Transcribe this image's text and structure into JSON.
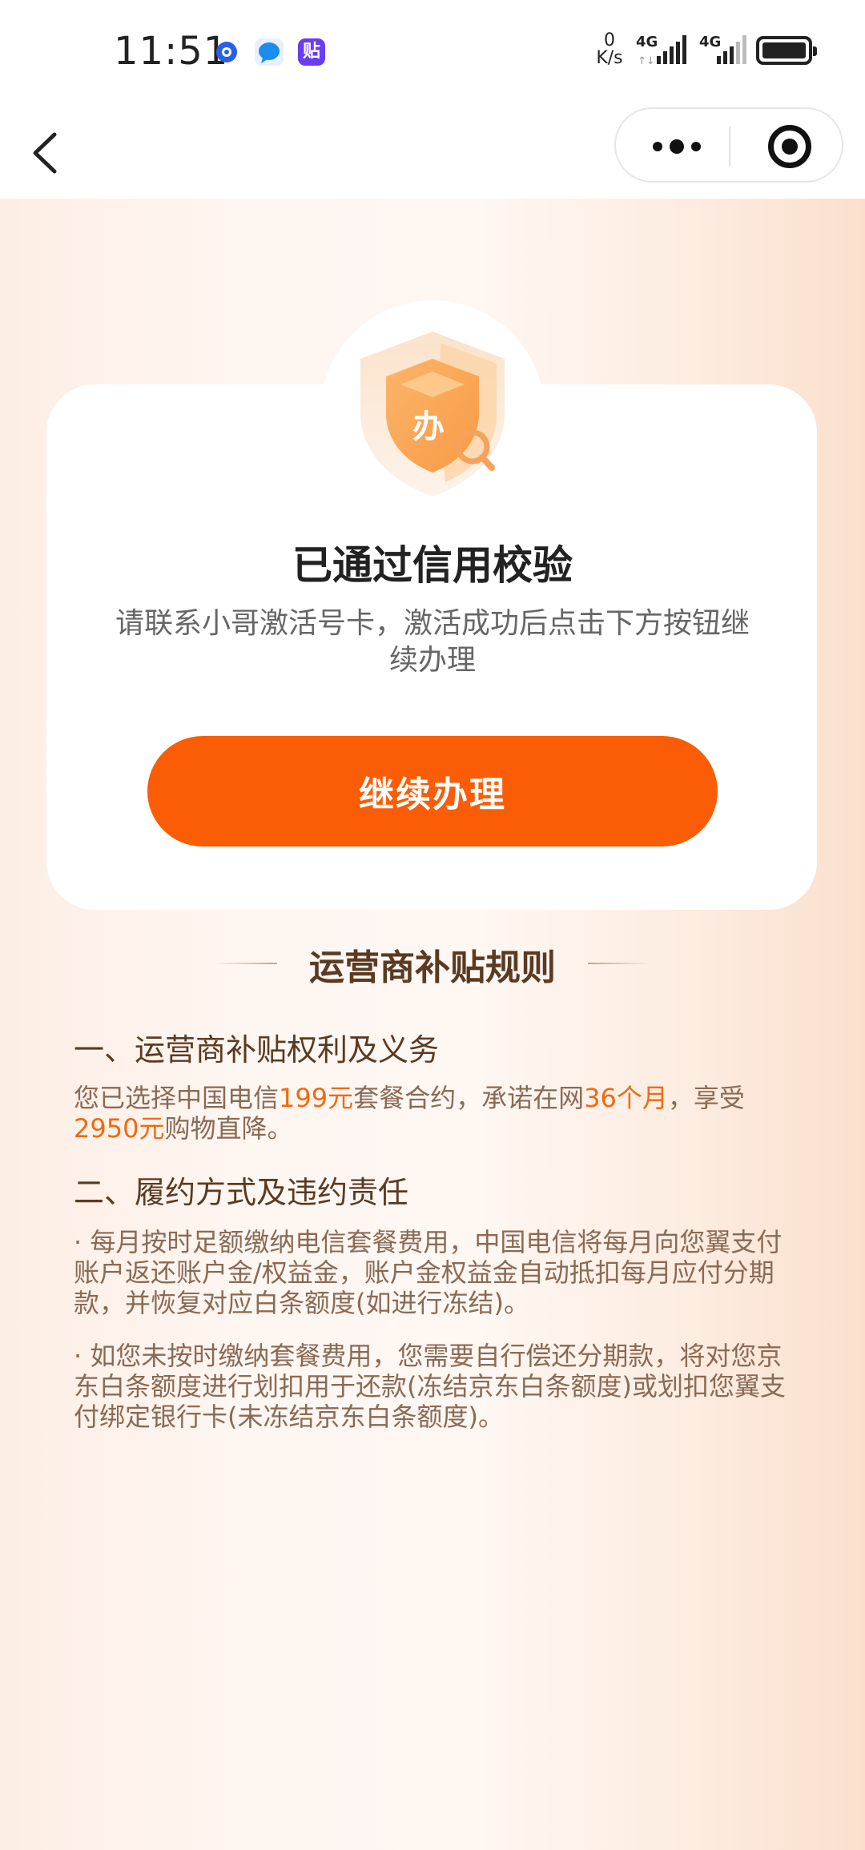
{
  "status_bar": {
    "time": "11:51",
    "net_speed_value": "0",
    "net_speed_unit": "K/s",
    "signal_1_label": "4G",
    "signal_2_label": "4G",
    "notif_3_label": "贴"
  },
  "nav": {
    "back_icon": "chevron-left-icon",
    "more_icon": "more-dots-icon",
    "close_icon": "target-circle-icon"
  },
  "card": {
    "badge_text": "办",
    "title": "已通过信用校验",
    "description": "请联系小哥激活号卡，激活成功后点击下方按钮继续办理",
    "button_label": "继续办理"
  },
  "rules": {
    "title": "运营商补贴规则",
    "section1": {
      "title": "一、运营商补贴权利及义务",
      "text_1": "您已选择中国电信",
      "plan_price": "199元",
      "text_2": "套餐合约，承诺在网",
      "contract_term": "36个月",
      "text_3": "，享受",
      "discount": "2950元",
      "text_4": "购物直降。"
    },
    "section2": {
      "title": "二、履约方式及违约责任",
      "item1": "· 每月按时足额缴纳电信套餐费用，中国电信将每月向您翼支付账户返还账户金/权益金，账户金权益金自动抵扣每月应付分期款，并恢复对应白条额度(如进行冻结)。",
      "item2": "· 如您未按时缴纳套餐费用，您需要自行偿还分期款，将对您京东白条额度进行划扣用于还款(冻结京东白条额度)或划扣您翼支付绑定银行卡(未冻结京东白条额度)。"
    }
  },
  "colors": {
    "accent": "#fa5d05",
    "highlight": "#f06a10",
    "rules_text": "#8a6a55",
    "rules_heading": "#5a3a22"
  }
}
